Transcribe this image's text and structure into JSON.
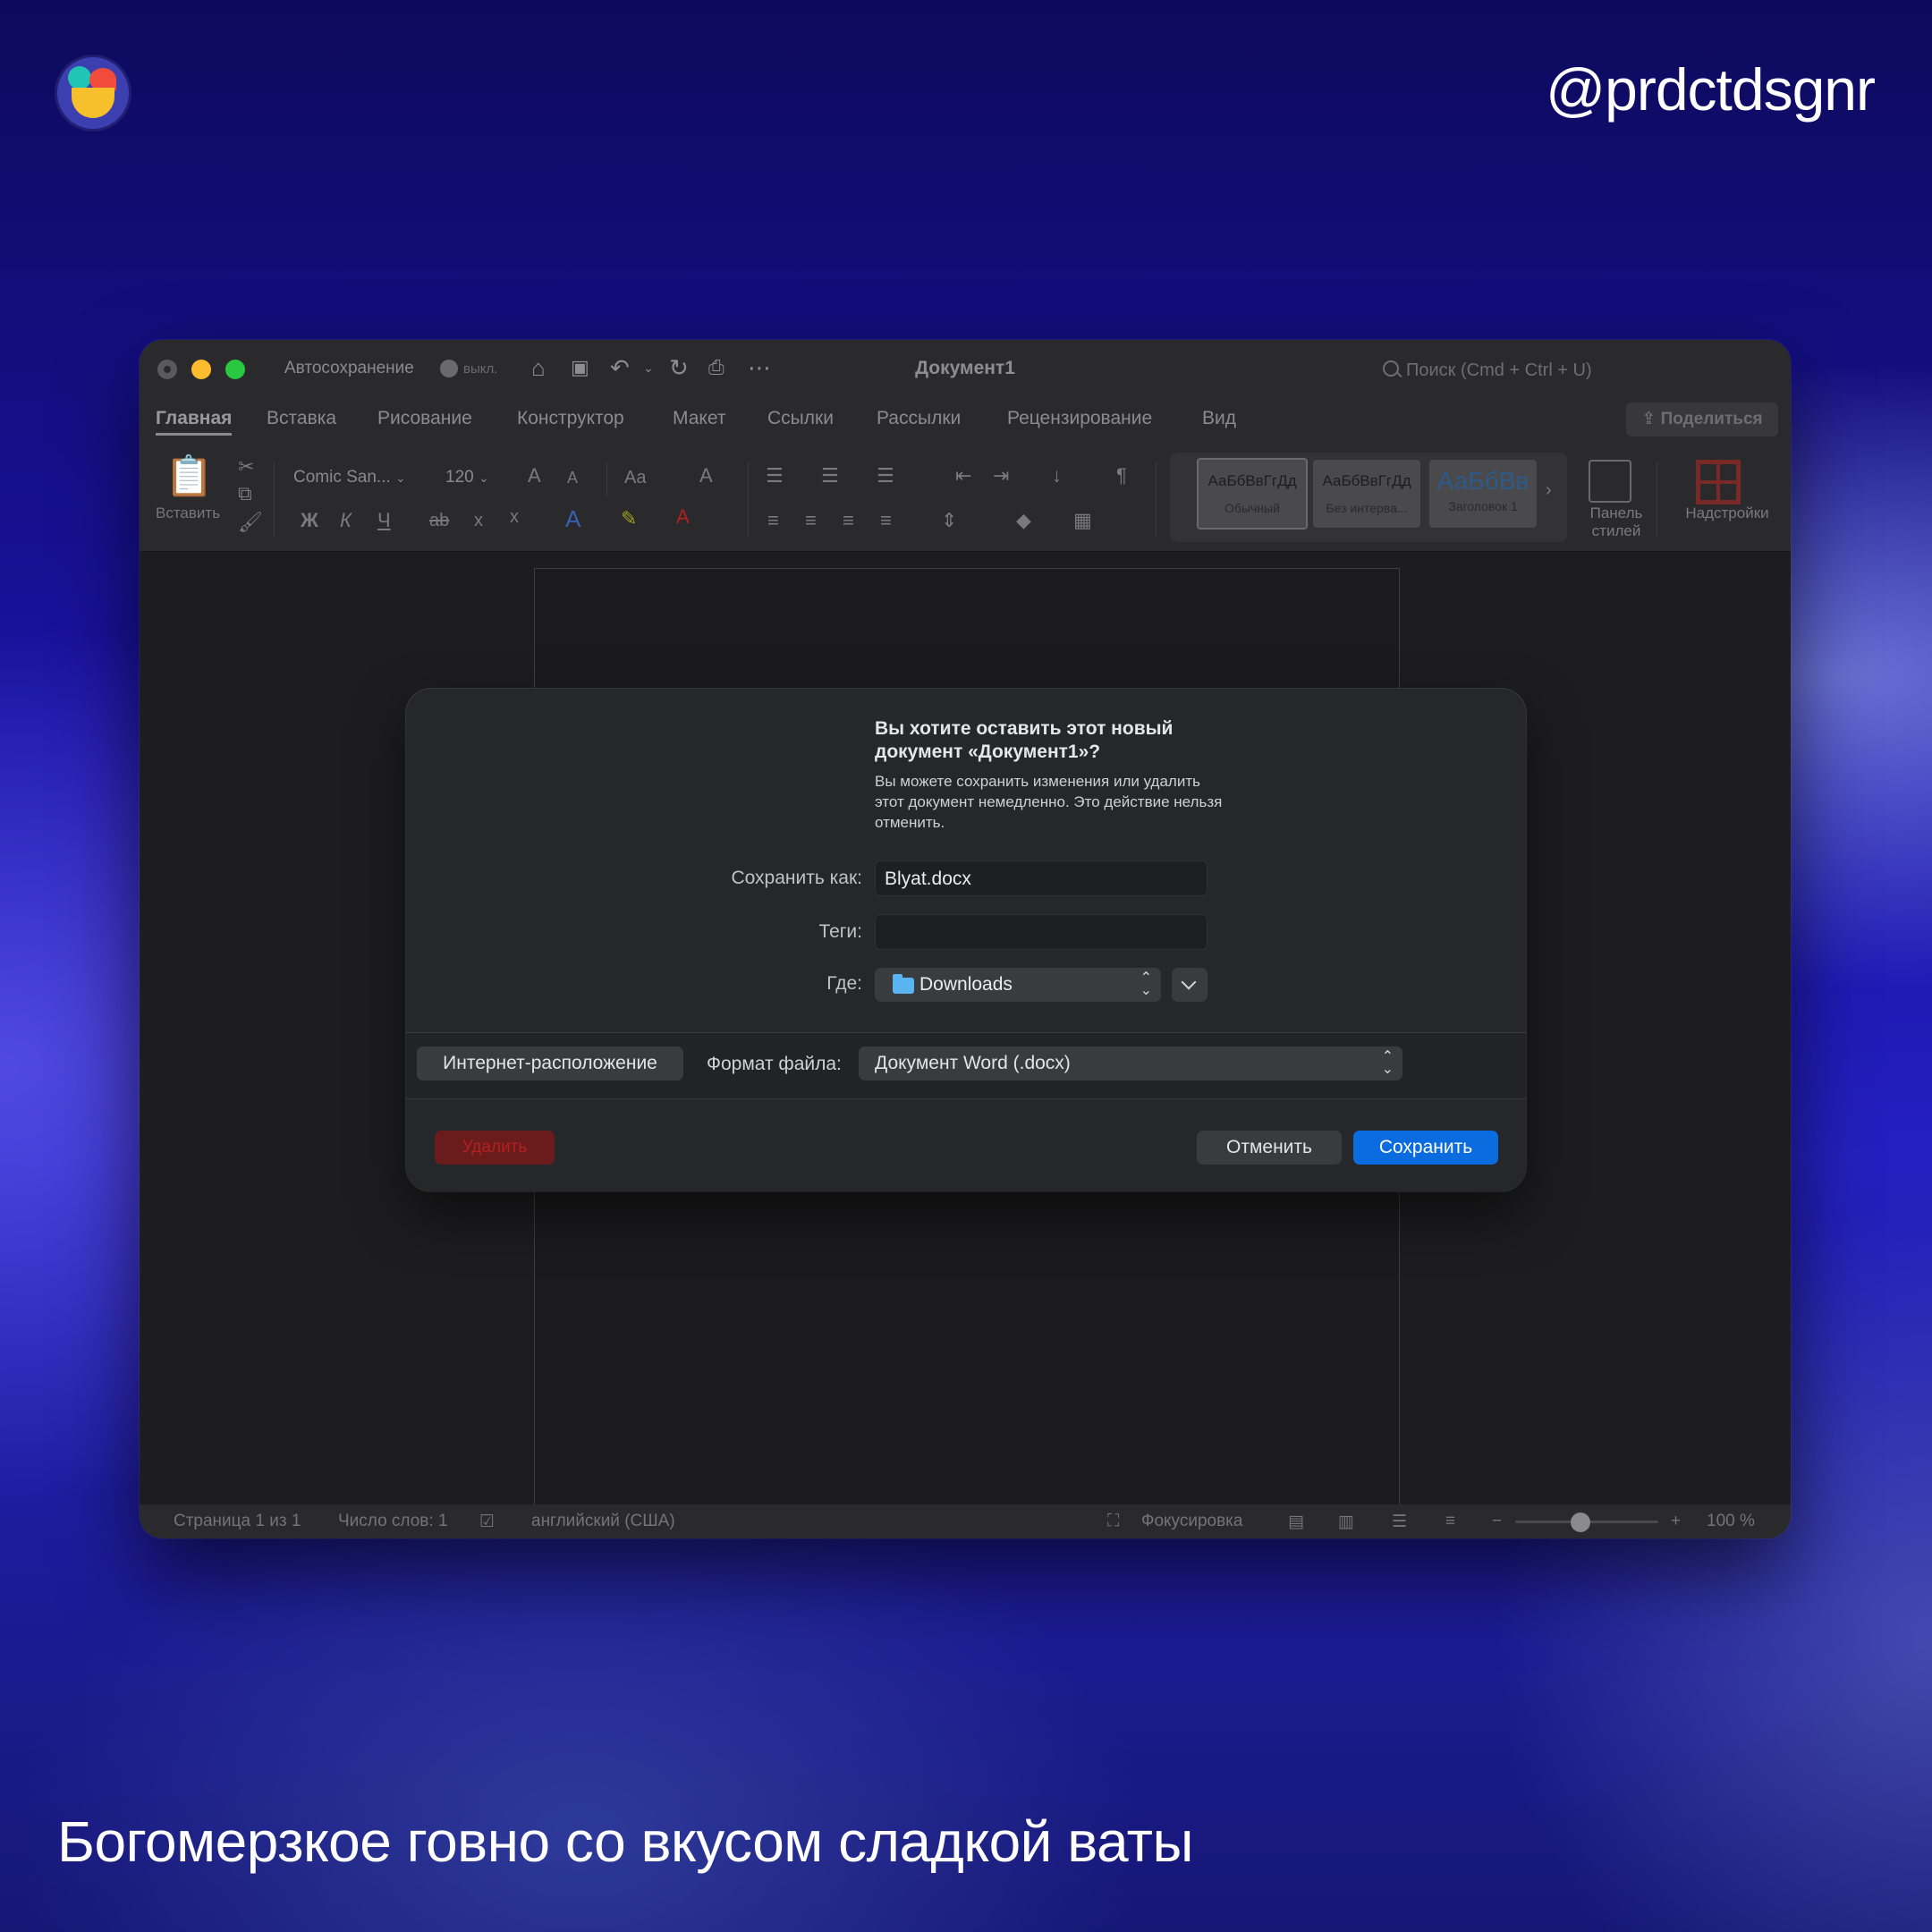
{
  "overlay": {
    "handle": "@prdctdsgnr",
    "caption": "Богомерзкое говно со вкусом сладкой ваты"
  },
  "window": {
    "title": "Документ1",
    "autosave_label": "Автосохранение",
    "autosave_state": "выкл.",
    "search_placeholder": "Поиск (Cmd + Ctrl + U)",
    "share_label": "Поделиться"
  },
  "tabs": [
    {
      "label": "Главная",
      "active": true
    },
    {
      "label": "Вставка"
    },
    {
      "label": "Рисование"
    },
    {
      "label": "Конструктор"
    },
    {
      "label": "Макет"
    },
    {
      "label": "Ссылки"
    },
    {
      "label": "Рассылки"
    },
    {
      "label": "Рецензирование"
    },
    {
      "label": "Вид"
    }
  ],
  "ribbon": {
    "paste_label": "Вставить",
    "font_name": "Comic San...",
    "font_size": "120",
    "case_label": "Aa",
    "bold": "Ж",
    "italic": "К",
    "underline": "Ч",
    "strike": "ab",
    "sub": "x",
    "sup": "x",
    "styles": [
      {
        "preview": "АаБбВвГгДд",
        "name": "Обычный",
        "selected": true
      },
      {
        "preview": "АаБбВвГгДд",
        "name": "Без интерва..."
      },
      {
        "preview": "АаБбВв",
        "name": "Заголовок 1"
      }
    ],
    "styles_panel_label": "Панель стилей",
    "addins_label": "Надстройки"
  },
  "dialog": {
    "title": "Вы хотите оставить этот новый документ «Документ1»?",
    "text": "Вы можете сохранить изменения или удалить этот документ немедленно. Это действие нельзя отменить.",
    "save_as_label": "Сохранить как:",
    "save_as_value": "Blyat.docx",
    "tags_label": "Теги:",
    "tags_value": "",
    "where_label": "Где:",
    "where_value": "Downloads",
    "internet_button": "Интернет-расположение",
    "format_label": "Формат файла:",
    "format_value": "Документ Word (.docx)",
    "delete_button": "Удалить",
    "cancel_button": "Отменить",
    "save_button": "Сохранить"
  },
  "status": {
    "page": "Страница 1 из 1",
    "words": "Число слов: 1",
    "language": "английский (США)",
    "focus": "Фокусировка",
    "zoom": "100 %",
    "zoom_percent": 100
  }
}
